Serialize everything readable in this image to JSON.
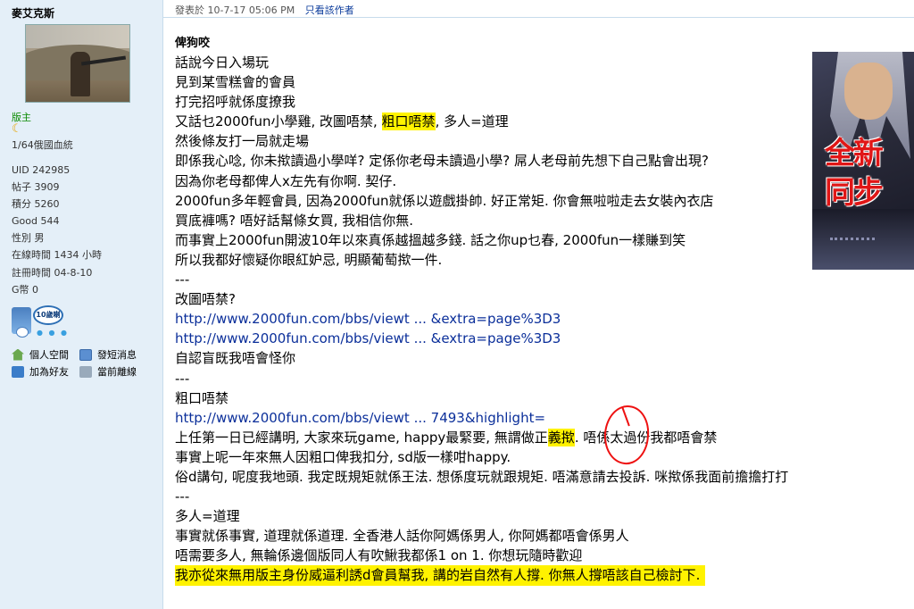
{
  "user": {
    "name": "麥艾克斯",
    "rank": "版主",
    "bloodline": "1/64俄國血統",
    "stats": [
      {
        "label": "UID",
        "value": "242985"
      },
      {
        "label": "帖子",
        "value": "3909"
      },
      {
        "label": "積分",
        "value": "5260"
      },
      {
        "label": "Good",
        "value": "544"
      },
      {
        "label": "性別",
        "value": "男"
      },
      {
        "label": "在線時間",
        "value": "1434 小時"
      },
      {
        "label": "註冊時間",
        "value": "04-8-10"
      },
      {
        "label": "G幣",
        "value": "0"
      }
    ],
    "badge_text": "10歲喇",
    "actions": {
      "profile": "個人空間",
      "message": "發短消息",
      "add_friend": "加為好友",
      "status": "當前離線"
    }
  },
  "post": {
    "posted_label": "發表於 10-7-17 05:06 PM",
    "author_only": "只看該作者",
    "title": "俾狗咬",
    "lines": [
      "話說今日入場玩",
      "見到某雪糕會的會員",
      "打完招呼就係度撩我",
      [
        "又話乜2000fun小學雞, 改圖唔禁, ",
        "粗口唔禁",
        ", 多人=道理"
      ],
      "然後條友打一局就走場",
      "即係我心唸, 你未揿讀過小學咩? 定係你老母未讀過小學? 屌人老母前先想下自己點會出現?",
      "因為你老母都俾人x左先有你啊. 契仔.",
      "2000fun多年輕會員, 因為2000fun就係以遊戲掛帥. 好正常矩. 你會無啦啦走去女裝內衣店",
      "買底褲嗎? 唔好話幫條女買, 我相信你無.",
      "而事實上2000fun開波10年以來真係越搵越多錢. 話之你up乜春, 2000fun一樣賺到笑",
      "所以我都好懷疑你眼紅妒忌, 明顯葡萄揿一件.",
      "---",
      "改圖唔禁?",
      "http://www.2000fun.com/bbs/viewt ... &extra=page%3D3",
      "http://www.2000fun.com/bbs/viewt ... &extra=page%3D3",
      "自認盲既我唔會怪你",
      "---",
      "粗口唔禁",
      "http://www.2000fun.com/bbs/viewt ... 7493&highlight=",
      [
        "上任第一日已經講明, 大家來玩game, happy最緊要, 無謂做正",
        "義揿",
        ". 唔係太過份我都唔會禁"
      ],
      "事實上呢一年來無人因粗口俾我扣分, sd版一樣咁happy.",
      "俗d講句, 呢度我地頭. 我定既規矩就係王法. 想係度玩就跟規矩. 唔滿意請去投訴. 咪揿係我面前擔擔打打",
      "---",
      "多人=道理",
      "事實就係事實, 道理就係道理. 全香港人話你阿媽係男人, 你阿媽都唔會係男人",
      "唔需要多人, 無輪係邊個版同人有吹鰍我都係1 on 1. 你想玩隨時歡迎",
      "我亦從來無用版主身份威逼利誘d會員幫我, 講的岩自然有人撐. 你無人撐唔該自己檢討下."
    ]
  },
  "ad": {
    "line1": "全新",
    "line2": "同步"
  },
  "colors": {
    "sidebar_bg": "#e4eff8",
    "highlight": "#fff200",
    "link": "#0b2f9a",
    "rank": "#0a8a00",
    "annotation": "#ee1111"
  }
}
